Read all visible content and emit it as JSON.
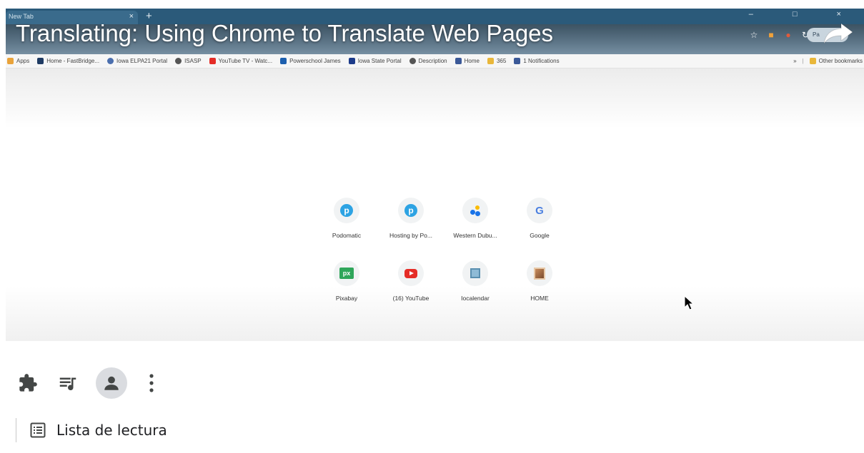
{
  "video": {
    "title": "Translating: Using Chrome to Translate Web Pages",
    "browser": {
      "tab_title": "New Tab",
      "tab_close": "×",
      "new_tab": "+",
      "window_controls": "–  □  ×",
      "profile_label": "Pa"
    },
    "bookmarks": [
      {
        "label": "Apps",
        "color": "#e9a33a"
      },
      {
        "label": "Home - FastBridge...",
        "color": "#1f3b63"
      },
      {
        "label": "Iowa ELPA21 Portal",
        "color": "#4b6fae"
      },
      {
        "label": "ISASP",
        "color": "#555555"
      },
      {
        "label": "YouTube TV - Watc...",
        "color": "#e52d27"
      },
      {
        "label": "Powerschool James",
        "color": "#1d5fae"
      },
      {
        "label": "Iowa State Portal",
        "color": "#1d3b8a"
      },
      {
        "label": "Description",
        "color": "#555555"
      },
      {
        "label": "Home",
        "color": "#3b5998"
      },
      {
        "label": "365",
        "color": "#e9b73a"
      },
      {
        "label": "1 Notifications",
        "color": "#3b5998"
      }
    ],
    "bookmarks_overflow": "»",
    "other_bookmarks": "Other bookmarks",
    "shortcuts": [
      {
        "label": "Podomatic",
        "icon": "podomatic-icon"
      },
      {
        "label": "Hosting by Po...",
        "icon": "podomatic-icon"
      },
      {
        "label": "Western Dubu...",
        "icon": "dots-icon"
      },
      {
        "label": "Google",
        "icon": "google-icon"
      },
      {
        "label": "Pixabay",
        "icon": "pixabay-icon"
      },
      {
        "label": "(16) YouTube",
        "icon": "youtube-icon"
      },
      {
        "label": "Iocalendar",
        "icon": "calendar-icon"
      },
      {
        "label": "HOME",
        "icon": "home-image-icon"
      }
    ],
    "glyphs": {
      "podomatic": "p",
      "google": "G",
      "pixabay": "px"
    }
  },
  "reading_list": {
    "label": "Lista de lectura"
  },
  "colors": {
    "toolbar": "#6a8aa2",
    "tabstrip": "#2b5a7a",
    "avatar_bg": "#dadce0",
    "icon": "#444746"
  }
}
